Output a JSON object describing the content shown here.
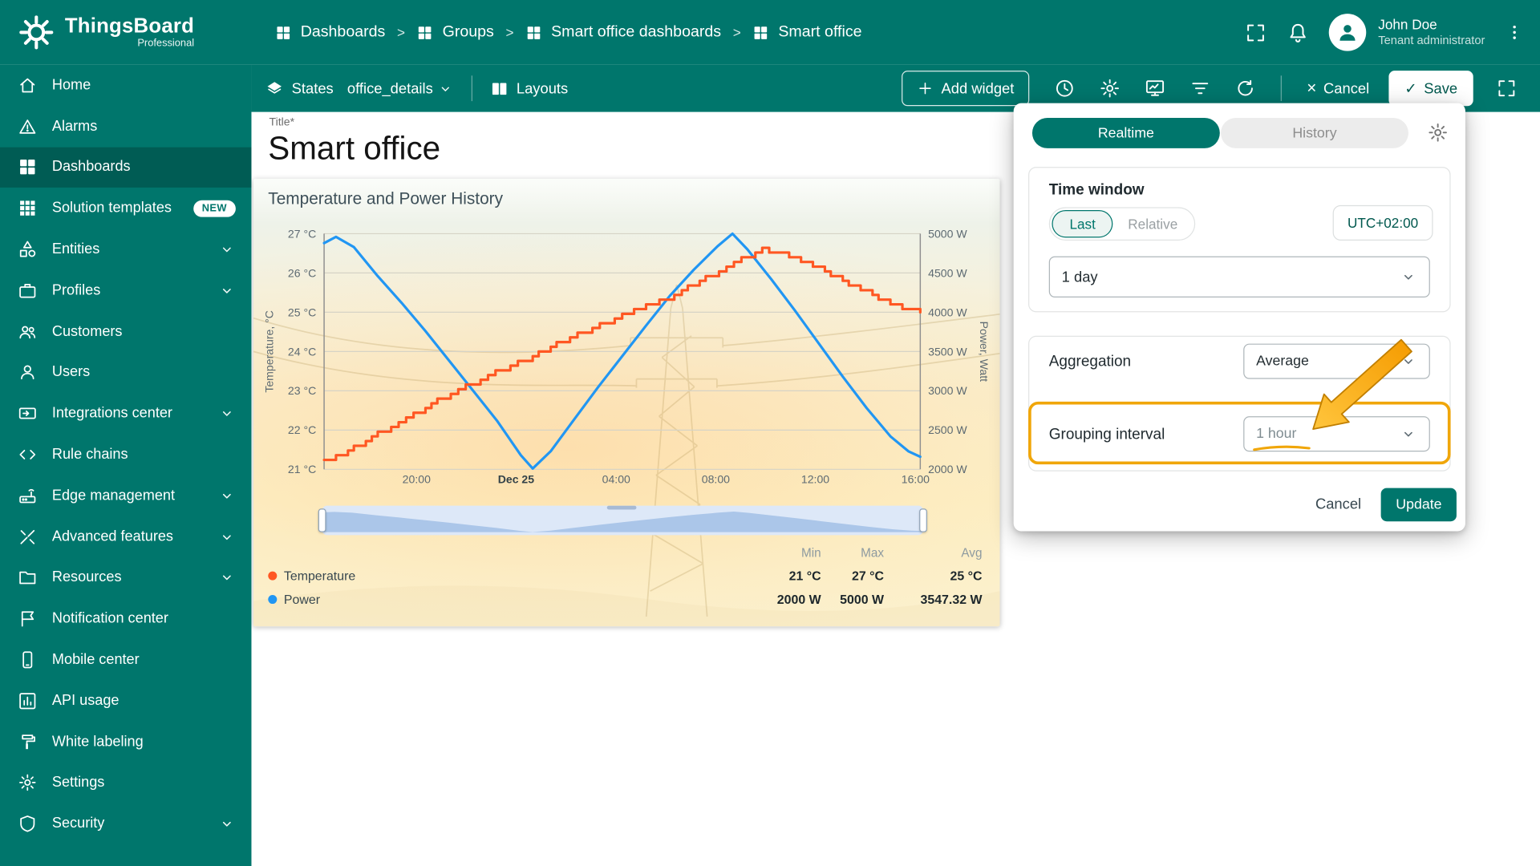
{
  "app": {
    "name": "ThingsBoard",
    "edition": "Professional"
  },
  "header": {
    "breadcrumb": [
      "Dashboards",
      "Groups",
      "Smart office dashboards",
      "Smart office"
    ],
    "separator": ">",
    "user": {
      "name": "John Doe",
      "role": "Tenant administrator"
    }
  },
  "toolbar": {
    "states_label": "States",
    "state_value": "office_details",
    "layouts_label": "Layouts",
    "add_widget_label": "Add widget",
    "cancel_label": "Cancel",
    "save_label": "Save"
  },
  "sidebar": {
    "items": [
      {
        "label": "Home",
        "icon": "home"
      },
      {
        "label": "Alarms",
        "icon": "alarm"
      },
      {
        "label": "Dashboards",
        "icon": "dashboards",
        "active": true
      },
      {
        "label": "Solution templates",
        "icon": "templates",
        "badge": "NEW"
      },
      {
        "label": "Entities",
        "icon": "entities",
        "expandable": true
      },
      {
        "label": "Profiles",
        "icon": "profiles",
        "expandable": true
      },
      {
        "label": "Customers",
        "icon": "customers"
      },
      {
        "label": "Users",
        "icon": "user"
      },
      {
        "label": "Integrations center",
        "icon": "integrations",
        "expandable": true
      },
      {
        "label": "Rule chains",
        "icon": "rulechains"
      },
      {
        "label": "Edge management",
        "icon": "edge",
        "expandable": true
      },
      {
        "label": "Advanced features",
        "icon": "advanced",
        "expandable": true
      },
      {
        "label": "Resources",
        "icon": "resources",
        "expandable": true
      },
      {
        "label": "Notification center",
        "icon": "notification"
      },
      {
        "label": "Mobile center",
        "icon": "mobile"
      },
      {
        "label": "API usage",
        "icon": "api"
      },
      {
        "label": "White labeling",
        "icon": "whitelabel"
      },
      {
        "label": "Settings",
        "icon": "settings"
      },
      {
        "label": "Security",
        "icon": "security",
        "expandable": true
      }
    ]
  },
  "dashboard": {
    "title_label": "Title*",
    "title_value": "Smart office"
  },
  "chart_data": {
    "type": "line",
    "title": "Temperature and Power History",
    "x_ticks": [
      {
        "label": "20:00",
        "pos": 0.155
      },
      {
        "label": "Dec 25",
        "pos": 0.322,
        "bold": true
      },
      {
        "label": "04:00",
        "pos": 0.49
      },
      {
        "label": "08:00",
        "pos": 0.657
      },
      {
        "label": "12:00",
        "pos": 0.824
      },
      {
        "label": "16:00",
        "pos": 0.992
      }
    ],
    "y_left": {
      "title": "Temperature, °C",
      "min": 21,
      "max": 27,
      "ticks": [
        "27 °C",
        "26 °C",
        "25 °C",
        "24 °C",
        "23 °C",
        "22 °C",
        "21 °C"
      ]
    },
    "y_right": {
      "title": "Power, Watt",
      "min": 2000,
      "max": 5000,
      "ticks": [
        "5000 W",
        "4500 W",
        "4000 W",
        "3500 W",
        "3000 W",
        "2500 W",
        "2000 W"
      ]
    },
    "series": [
      {
        "name": "Power",
        "color": "#2196F3",
        "axis": "right",
        "style": "line",
        "points": [
          [
            0,
            4880
          ],
          [
            0.02,
            4960
          ],
          [
            0.05,
            4830
          ],
          [
            0.09,
            4460
          ],
          [
            0.13,
            4120
          ],
          [
            0.17,
            3760
          ],
          [
            0.21,
            3380
          ],
          [
            0.25,
            3000
          ],
          [
            0.29,
            2620
          ],
          [
            0.33,
            2180
          ],
          [
            0.35,
            2010
          ],
          [
            0.38,
            2230
          ],
          [
            0.42,
            2640
          ],
          [
            0.46,
            3050
          ],
          [
            0.5,
            3440
          ],
          [
            0.54,
            3830
          ],
          [
            0.58,
            4210
          ],
          [
            0.62,
            4540
          ],
          [
            0.66,
            4840
          ],
          [
            0.685,
            5000
          ],
          [
            0.71,
            4800
          ],
          [
            0.75,
            4420
          ],
          [
            0.79,
            4020
          ],
          [
            0.83,
            3600
          ],
          [
            0.87,
            3180
          ],
          [
            0.91,
            2780
          ],
          [
            0.95,
            2420
          ],
          [
            0.98,
            2230
          ],
          [
            1,
            2160
          ]
        ]
      },
      {
        "name": "Temperature",
        "color": "#FF5722",
        "axis": "left",
        "style": "step",
        "points": [
          [
            0,
            21.2
          ],
          [
            0.05,
            21.55
          ],
          [
            0.1,
            22.0
          ],
          [
            0.15,
            22.4
          ],
          [
            0.2,
            22.85
          ],
          [
            0.25,
            23.2
          ],
          [
            0.3,
            23.55
          ],
          [
            0.35,
            23.9
          ],
          [
            0.4,
            24.25
          ],
          [
            0.45,
            24.6
          ],
          [
            0.5,
            24.9
          ],
          [
            0.55,
            25.2
          ],
          [
            0.6,
            25.55
          ],
          [
            0.65,
            25.95
          ],
          [
            0.7,
            26.35
          ],
          [
            0.735,
            26.6
          ],
          [
            0.77,
            26.5
          ],
          [
            0.81,
            26.25
          ],
          [
            0.85,
            25.95
          ],
          [
            0.89,
            25.65
          ],
          [
            0.93,
            25.35
          ],
          [
            0.97,
            25.1
          ],
          [
            1,
            25.0
          ]
        ]
      }
    ],
    "legend": {
      "columns": [
        "Min",
        "Max",
        "Avg"
      ],
      "rows": [
        {
          "name": "Temperature",
          "color": "#FF5722",
          "values": [
            "21 °C",
            "27 °C",
            "25 °C"
          ]
        },
        {
          "name": "Power",
          "color": "#2196F3",
          "values": [
            "2000 W",
            "5000 W",
            "3547.32 W"
          ]
        }
      ]
    }
  },
  "timewindow": {
    "tabs": [
      {
        "label": "Realtime",
        "active": true
      },
      {
        "label": "History",
        "active": false
      }
    ],
    "section_title": "Time window",
    "last_label": "Last",
    "relative_label": "Relative",
    "timezone": "UTC+02:00",
    "range_value": "1 day",
    "aggregation_label": "Aggregation",
    "aggregation_value": "Average",
    "grouping_label": "Grouping interval",
    "grouping_value": "1 hour",
    "cancel_label": "Cancel",
    "update_label": "Update"
  },
  "colors": {
    "primary": "#00766C",
    "power_series": "#2196F3",
    "temperature_series": "#FF5722",
    "annotation": "#F0A60A"
  }
}
